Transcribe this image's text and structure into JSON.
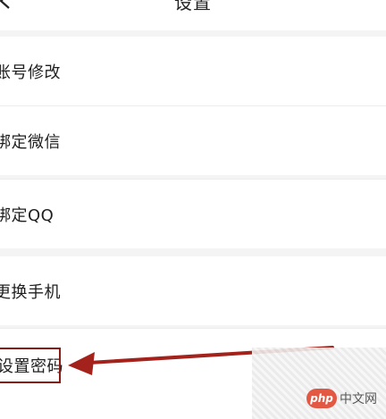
{
  "header": {
    "title": "设置",
    "back_icon": "chevron-left-icon"
  },
  "settings": {
    "items": [
      {
        "label": "账号修改"
      },
      {
        "label": "绑定微信"
      },
      {
        "label": "绑定QQ"
      },
      {
        "label": "更换手机"
      },
      {
        "label": "设置密码"
      }
    ]
  },
  "annotation": {
    "color": "#a3231c",
    "target": "设置密码"
  },
  "watermark": {
    "badge": "php",
    "text": "中文网"
  }
}
